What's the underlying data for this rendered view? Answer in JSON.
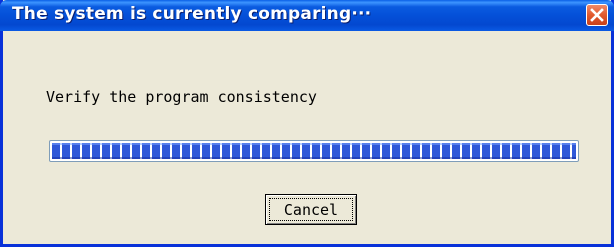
{
  "dialog": {
    "title": "The system is currently comparing···",
    "message": "Verify the program consistency",
    "progress": 1.0,
    "cancel_label": "Cancel"
  },
  "icons": {
    "close": "close-icon"
  },
  "colors": {
    "titlebar": "#0450d8",
    "progress_block": "#2f58d8",
    "close_button": "#e25a2e",
    "background": "#ece9d8"
  }
}
